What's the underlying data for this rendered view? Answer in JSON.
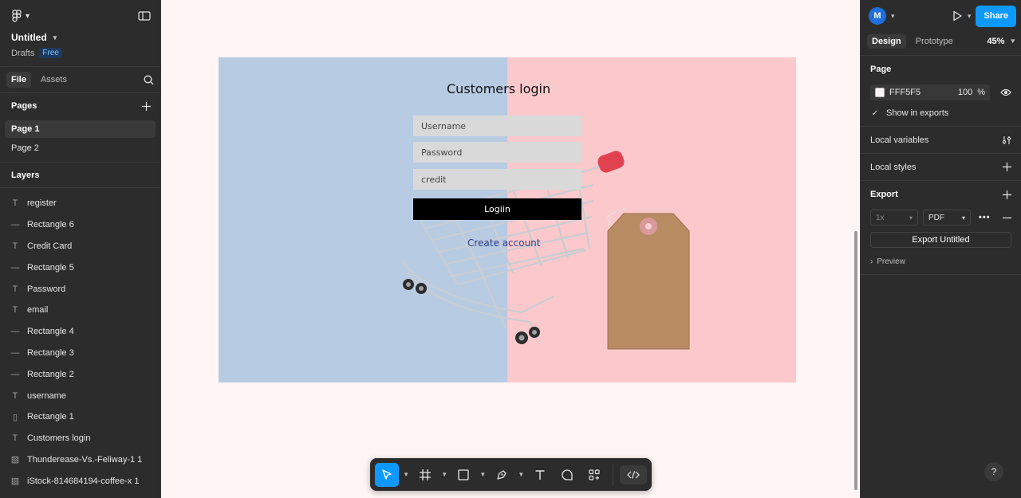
{
  "file": {
    "title": "Untitled",
    "location": "Drafts",
    "plan_badge": "Free"
  },
  "left_tabs": {
    "file": "File",
    "assets": "Assets"
  },
  "pages": {
    "heading": "Pages",
    "items": [
      {
        "label": "Page 1"
      },
      {
        "label": "Page 2"
      }
    ]
  },
  "layers": {
    "heading": "Layers",
    "items": [
      {
        "label": "register",
        "icon": "text-icon"
      },
      {
        "label": "Rectangle 6",
        "icon": "line-icon"
      },
      {
        "label": "Credit Card",
        "icon": "text-icon"
      },
      {
        "label": "Rectangle 5",
        "icon": "line-icon"
      },
      {
        "label": "Password",
        "icon": "text-icon"
      },
      {
        "label": "email",
        "icon": "text-icon"
      },
      {
        "label": "Rectangle 4",
        "icon": "line-icon"
      },
      {
        "label": "Rectangle 3",
        "icon": "line-icon"
      },
      {
        "label": "Rectangle 2",
        "icon": "line-icon"
      },
      {
        "label": "username",
        "icon": "text-icon"
      },
      {
        "label": "Rectangle 1",
        "icon": "frame-icon"
      },
      {
        "label": "Customers login",
        "icon": "text-icon"
      },
      {
        "label": "Thunderease-Vs.-Feliway-1 1",
        "icon": "image-icon"
      },
      {
        "label": "iStock-814684194-coffee-x 1",
        "icon": "image-icon"
      }
    ]
  },
  "design": {
    "title": "Customers login",
    "username_placeholder": "Username",
    "password_placeholder": "Password",
    "credit_placeholder": "credit",
    "login_button": "Logiin",
    "create_account": "Create account"
  },
  "right_panel": {
    "avatar_initial": "M",
    "share_label": "Share",
    "tab_design": "Design",
    "tab_prototype": "Prototype",
    "zoom": "45%",
    "page_heading": "Page",
    "page_fill_hex": "FFF5F5",
    "page_fill_opacity": "100",
    "page_fill_percent": "%",
    "show_in_exports": "Show in exports",
    "local_variables": "Local variables",
    "local_styles": "Local styles",
    "export_heading": "Export",
    "export_scale": "1x",
    "export_format": "PDF",
    "export_button": "Export Untitled",
    "preview": "Preview",
    "help": "?"
  },
  "colors": {
    "accent": "#0d99ff",
    "panel_bg": "#2c2c2c",
    "canvas_bg": "#fff5f5",
    "design_left_bg": "#b7cbe3",
    "design_right_bg": "#fbc8cb",
    "login_button_bg": "#000000"
  }
}
